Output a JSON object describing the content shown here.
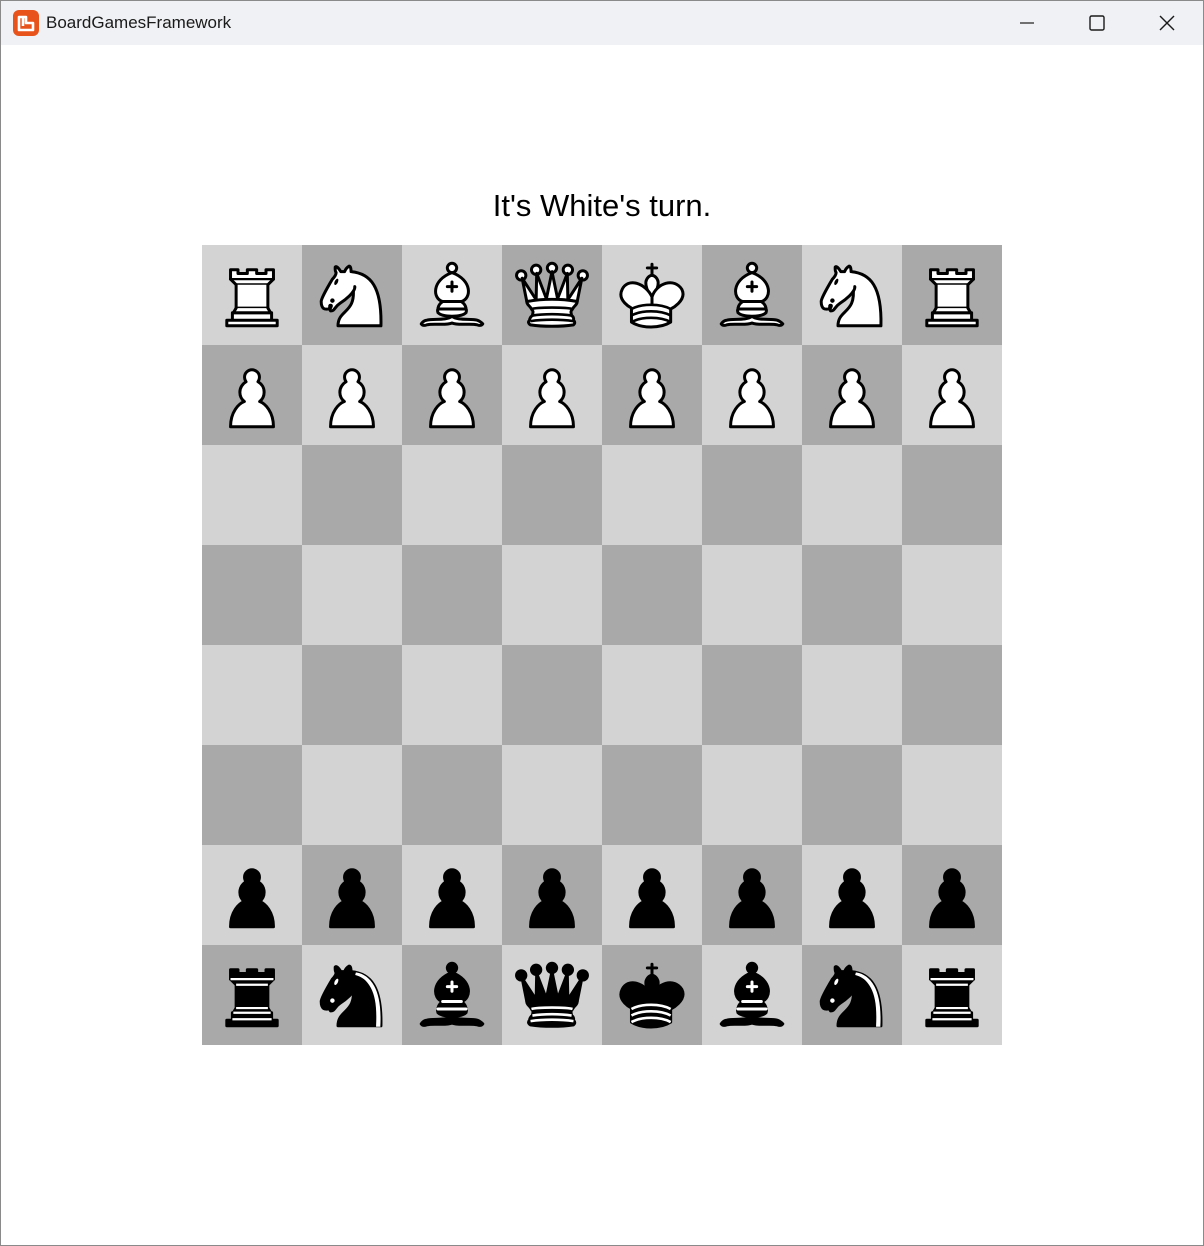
{
  "window": {
    "title": "BoardGamesFramework",
    "icon": "monogame-logo-icon",
    "controls": [
      "minimize-icon",
      "maximize-icon",
      "close-icon"
    ]
  },
  "status_text": "It's White's turn.",
  "board": {
    "light_color": "#d3d3d3",
    "dark_color": "#a9a9a9",
    "ranks": [
      [
        "wR",
        "wN",
        "wB",
        "wQ",
        "wK",
        "wB",
        "wN",
        "wR"
      ],
      [
        "wP",
        "wP",
        "wP",
        "wP",
        "wP",
        "wP",
        "wP",
        "wP"
      ],
      [
        "",
        "",
        "",
        "",
        "",
        "",
        "",
        ""
      ],
      [
        "",
        "",
        "",
        "",
        "",
        "",
        "",
        ""
      ],
      [
        "",
        "",
        "",
        "",
        "",
        "",
        "",
        ""
      ],
      [
        "",
        "",
        "",
        "",
        "",
        "",
        "",
        ""
      ],
      [
        "bP",
        "bP",
        "bP",
        "bP",
        "bP",
        "bP",
        "bP",
        "bP"
      ],
      [
        "bR",
        "bN",
        "bB",
        "bQ",
        "bK",
        "bB",
        "bN",
        "bR"
      ]
    ],
    "piece_names": {
      "R": "rook",
      "N": "knight",
      "B": "bishop",
      "Q": "queen",
      "K": "king",
      "P": "pawn"
    },
    "color_names": {
      "w": "white",
      "b": "black"
    }
  }
}
